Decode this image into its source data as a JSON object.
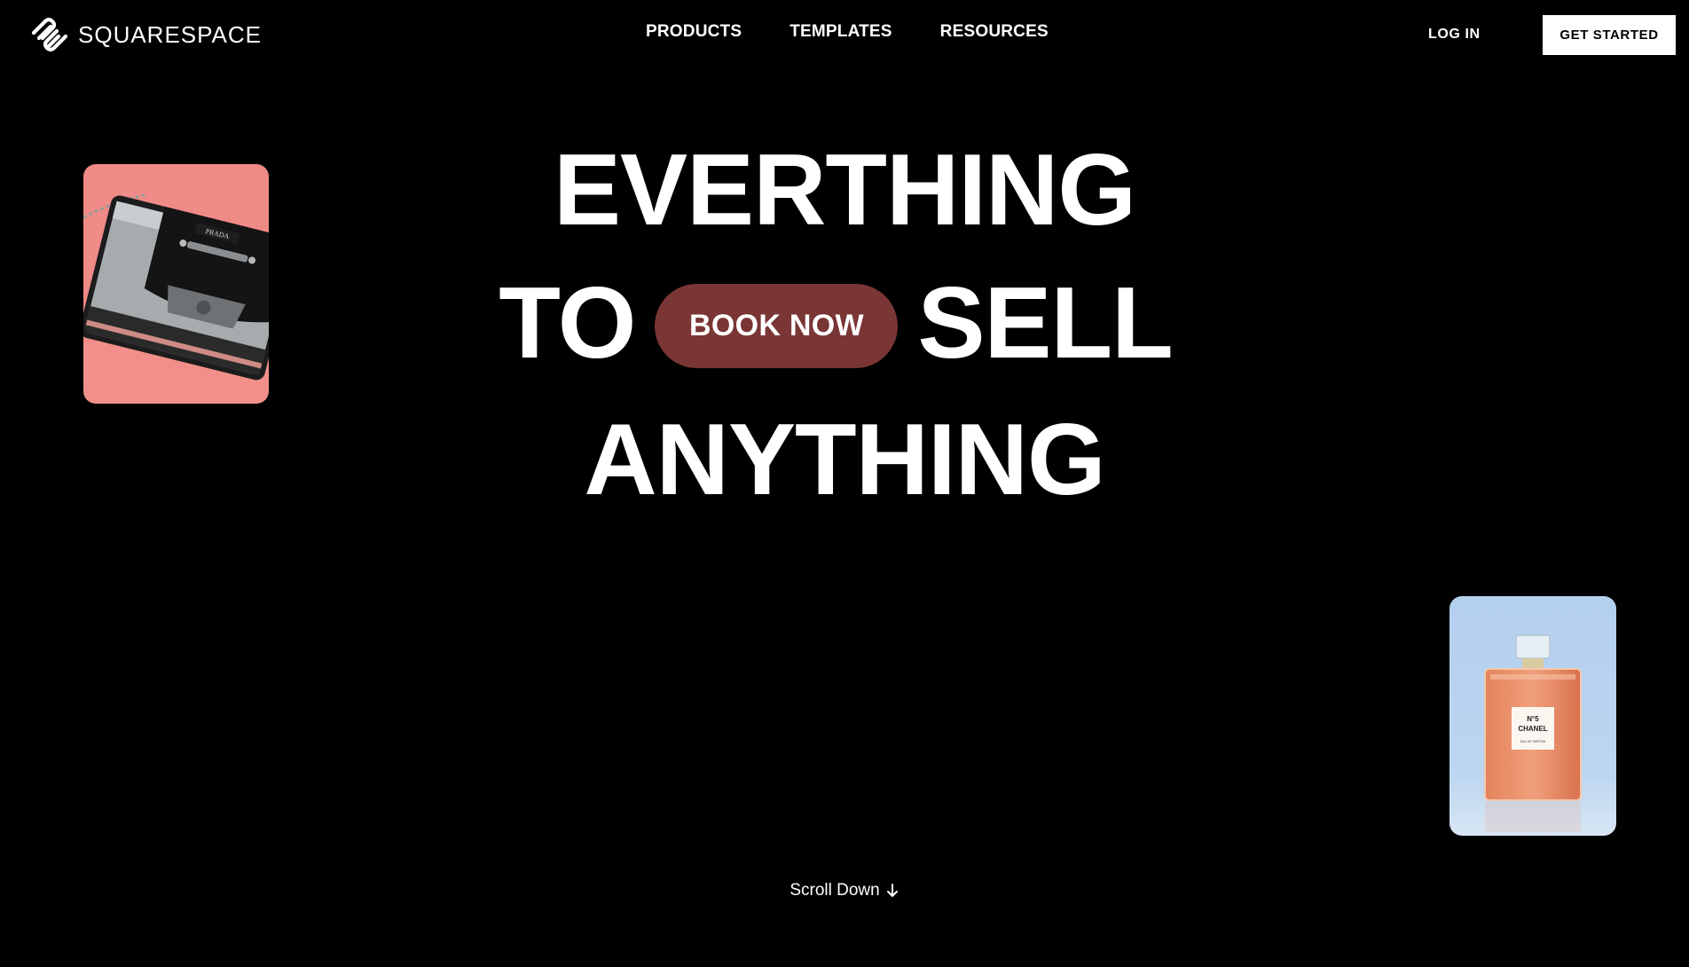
{
  "brand": {
    "name": "SQUARESPACE",
    "logo_icon": "squarespace-logo-icon"
  },
  "nav": {
    "items": [
      {
        "label": "PRODUCTS"
      },
      {
        "label": "TEMPLATES"
      },
      {
        "label": "RESOURCES"
      }
    ],
    "login_label": "LOG IN",
    "cta_label": "GET STARTED"
  },
  "hero": {
    "line1": "EVERTHING",
    "line2_left": "TO",
    "line2_right": "SELL",
    "line3": "ANYTHING",
    "book_label": "BOOK NOW",
    "book_color": "#7a3535"
  },
  "cards": {
    "bag": {
      "brand_text": "PRADA",
      "background": "#f08080"
    },
    "perfume": {
      "label_line1": "N°5",
      "label_line2": "CHANEL",
      "label_line3": "EAU DE PARFUM",
      "background": "#b7d3f0"
    }
  },
  "footer": {
    "scroll_label": "Scroll Down",
    "scroll_icon": "arrow-down-icon"
  },
  "colors": {
    "background": "#000000",
    "text": "#ffffff",
    "accent": "#7a3535"
  }
}
